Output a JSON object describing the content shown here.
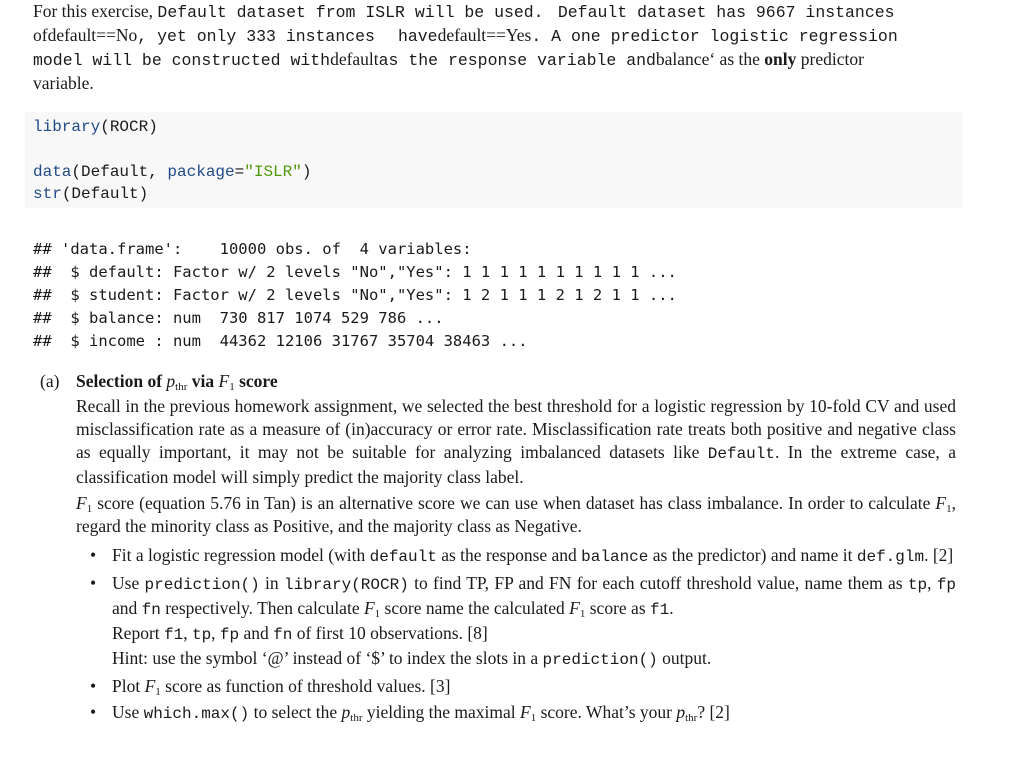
{
  "intro": {
    "line1": [
      "For this exercise, ",
      "Default dataset from ISLR will be used. ",
      "Default dataset has 9667 instances"
    ],
    "line2": [
      "of",
      "default==No",
      ", yet only 333 instances ",
      "have",
      "default==Yes",
      ". A one predictor logistic regression"
    ],
    "line3": [
      "model will be constructed with",
      "default",
      "as the response variable and",
      "balance",
      "‘ as the ",
      "only",
      " predictor"
    ],
    "line4": "variable."
  },
  "code": {
    "line1": {
      "fn": "library",
      "args": "(ROCR)"
    },
    "line3": {
      "fn": "data",
      "args_a": "(Default, ",
      "param": "package",
      "eq": "=",
      "string": "\"ISLR\"",
      "close": ")"
    },
    "line4": {
      "fn": "str",
      "args": "(Default)"
    }
  },
  "output": [
    "## 'data.frame':    10000 obs. of  4 variables:",
    "##  $ default: Factor w/ 2 levels \"No\",\"Yes\": 1 1 1 1 1 1 1 1 1 1 ...",
    "##  $ student: Factor w/ 2 levels \"No\",\"Yes\": 1 2 1 1 1 2 1 2 1 1 ...",
    "##  $ balance: num  730 817 1074 529 786 ...",
    "##  $ income : num  44362 12106 31767 35704 38463 ..."
  ],
  "section": {
    "number": "(a)",
    "title_a": "Selection of ",
    "title_p": "p",
    "title_p_sub": "thr",
    "title_b": " via ",
    "title_f": "F",
    "title_f_sub": "1",
    "title_c": " score",
    "para1": [
      "Recall in the previous homework assignment, we selected the best threshold for a logistic regression by 10-fold CV and used misclassification rate as a measure of (in)accuracy or error rate. Misclassification rate treats both positive and negative class as equally important, it may not be suitable for analyzing imbalanced datasets like ",
      "Default",
      ". In the extreme case, a classification model will simply predict the majority class label."
    ],
    "para2": {
      "f": "F",
      "f_sub": "1",
      "a": " score (equation 5.76 in Tan) is an alternative score we can use when dataset has class imbalance. In order to calculate ",
      "b": ", regard the minority class as Positive, and the majority class as Negative."
    },
    "tasks": [
      {
        "parts": [
          "Fit a logistic regression model (with ",
          "default",
          " as the response and ",
          "balance",
          " as the predictor) and name it ",
          "def.glm",
          ". [2]"
        ]
      },
      {
        "parts": [
          "Use ",
          "prediction()",
          " in ",
          "library(ROCR)",
          " to find TP, FP and FN for each cutoff threshold value, name them as ",
          "tp",
          ", ",
          "fp",
          " and ",
          "fn",
          " respectively. Then calculate ",
          " score name the calculated ",
          " score as ",
          "f1",
          ".",
          "Report ",
          "f1",
          ", ",
          "tp",
          ", ",
          "fp",
          " and ",
          "fn",
          " of first 10 observations. [8]",
          "Hint: use the symbol ‘@’ instead of ‘$’ to index the slots in a ",
          "prediction()",
          " output."
        ]
      },
      {
        "parts": [
          "Plot ",
          " score as function of threshold values. [3]"
        ]
      },
      {
        "parts": [
          "Use ",
          "which.max()",
          " to select the ",
          " yielding the maximal ",
          " score. What’s your ",
          "? [2]"
        ]
      }
    ],
    "bullet": "•"
  },
  "colors": {
    "code_bg": "#f8f8f8",
    "code_function": "#204a87",
    "code_string": "#4e9a06",
    "text": "#1a1a1a"
  }
}
